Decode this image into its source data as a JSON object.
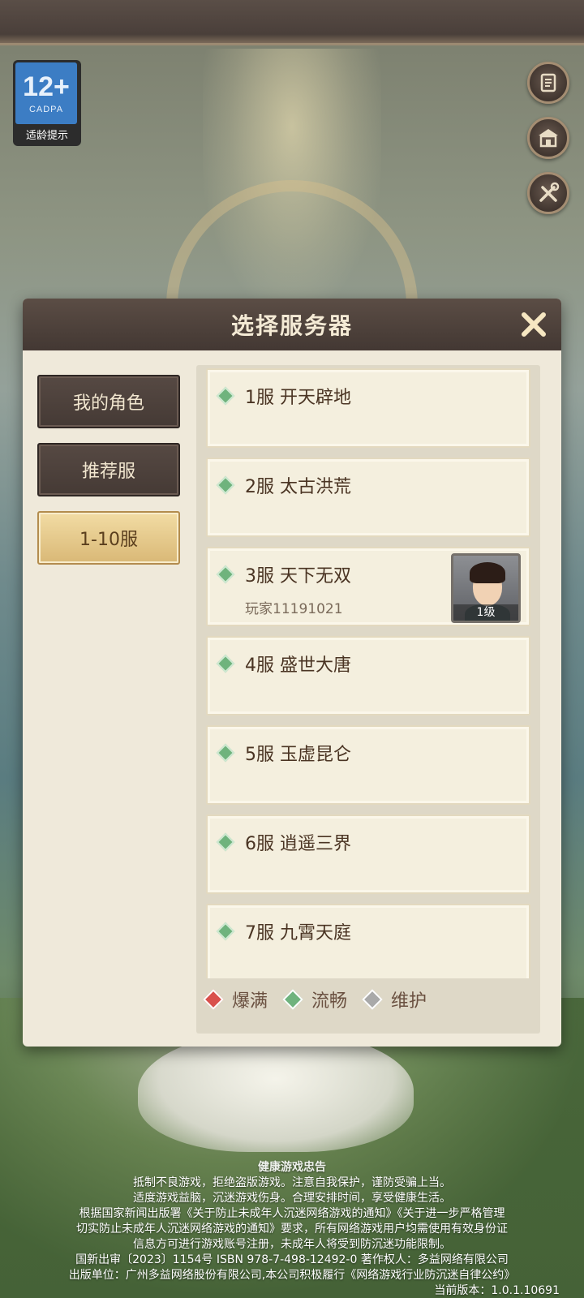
{
  "age_rating": {
    "number": "12+",
    "org": "CADPA",
    "caption": "适龄提示"
  },
  "side_icons": [
    "notice-scroll-icon",
    "temple-icon",
    "tools-icon"
  ],
  "dialog": {
    "title": "选择服务器",
    "tabs": [
      {
        "label": "我的角色",
        "active": false
      },
      {
        "label": "推荐服",
        "active": false
      },
      {
        "label": "1-10服",
        "active": true
      }
    ],
    "servers": [
      {
        "name": "1服 开天辟地",
        "status": "smooth"
      },
      {
        "name": "2服 太古洪荒",
        "status": "smooth"
      },
      {
        "name": "3服 天下无双",
        "status": "smooth",
        "player": "玩家11191021",
        "level": "1级"
      },
      {
        "name": "4服 盛世大唐",
        "status": "smooth"
      },
      {
        "name": "5服 玉虚昆仑",
        "status": "smooth"
      },
      {
        "name": "6服 逍遥三界",
        "status": "smooth"
      },
      {
        "name": "7服 九霄天庭",
        "status": "smooth"
      }
    ],
    "legend": [
      {
        "label": "爆满",
        "color": "#d9504c"
      },
      {
        "label": "流畅",
        "color": "#6fb37d"
      },
      {
        "label": "维护",
        "color": "#a9a9a9"
      }
    ]
  },
  "footer": {
    "heading": "健康游戏忠告",
    "lines": [
      "抵制不良游戏，拒绝盗版游戏。注意自我保护，谨防受骗上当。",
      "适度游戏益脑，沉迷游戏伤身。合理安排时间，享受健康生活。",
      "根据国家新闻出版署《关于防止未成年人沉迷网络游戏的通知》《关于进一步严格管理",
      "切实防止未成年人沉迷网络游戏的通知》要求，所有网络游戏用户均需使用有效身份证",
      "信息方可进行游戏账号注册，未成年人将受到防沉迷功能限制。",
      "国新出审〔2023〕1154号 ISBN 978-7-498-12492-0 著作权人：多益网络有限公司",
      "出版单位：广州多益网络股份有限公司,本公司积极履行《网络游戏行业防沉迷自律公约》"
    ],
    "version": "当前版本：1.0.1.10691"
  }
}
